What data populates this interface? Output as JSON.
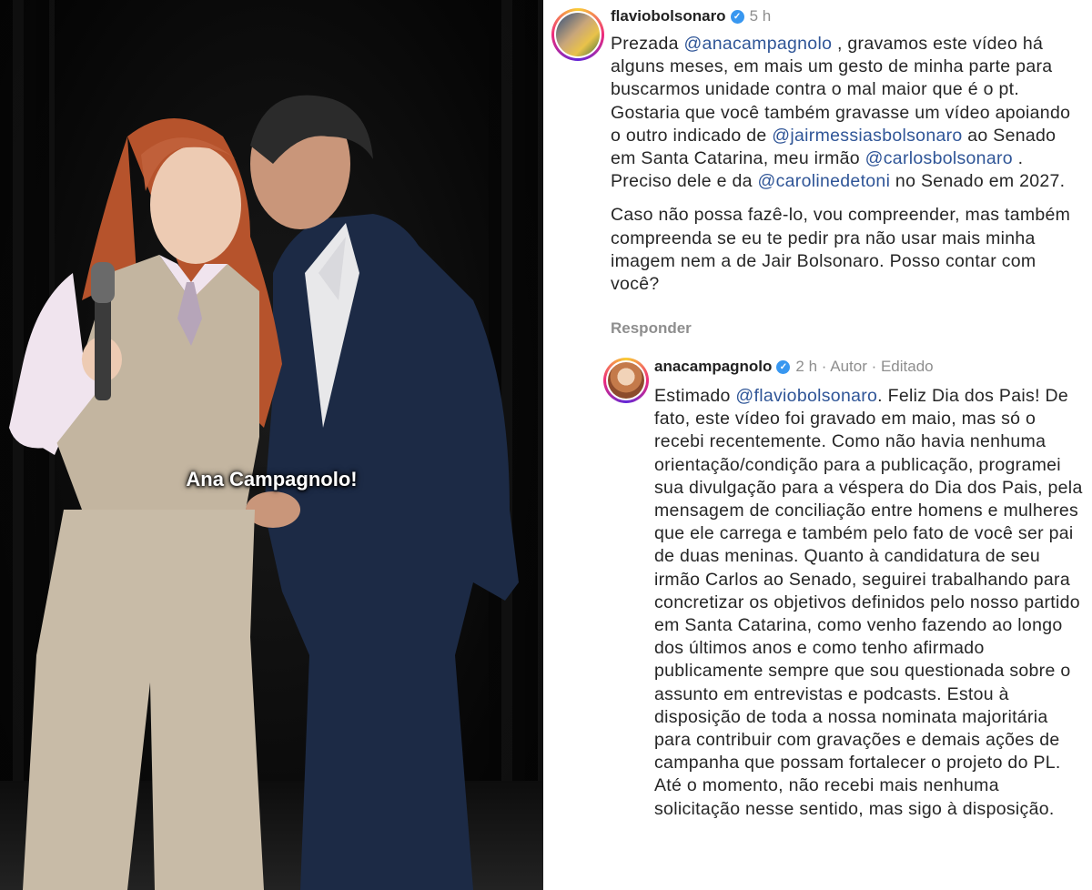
{
  "video": {
    "caption": "Ana Campagnolo!"
  },
  "comment1": {
    "username": "flaviobolsonaro",
    "time": "5 h",
    "segments": [
      {
        "t": "Prezada ",
        "m": false
      },
      {
        "t": "@anacampagnolo",
        "m": true
      },
      {
        "t": " , gravamos este vídeo há alguns meses, em mais um gesto de minha parte para buscarmos unidade contra o mal maior que é o pt. Gostaria que você também gravasse um vídeo apoiando o outro indicado de ",
        "m": false
      },
      {
        "t": "@jairmessiasbolsonaro",
        "m": true
      },
      {
        "t": " ao Senado em Santa Catarina, meu irmão ",
        "m": false
      },
      {
        "t": "@carlosbolsonaro",
        "m": true
      },
      {
        "t": " . Preciso dele e da ",
        "m": false
      },
      {
        "t": "@carolinedetoni",
        "m": true
      },
      {
        "t": " no Senado em 2027.",
        "m": false
      }
    ],
    "paragraph2": "Caso não possa fazê-lo, vou compreender, mas também compreenda se eu te pedir pra não usar mais minha imagem nem a de Jair Bolsonaro. Posso contar com você?",
    "reply_label": "Responder"
  },
  "comment2": {
    "username": "anacampagnolo",
    "meta": "2 h · Autor · Editado",
    "segments": [
      {
        "t": "Estimado ",
        "m": false
      },
      {
        "t": "@flaviobolsonaro",
        "m": true
      },
      {
        "t": ". Feliz Dia dos Pais! De fato, este vídeo foi gravado em maio, mas só o recebi recentemente. Como não havia nenhuma orientação/condição para a publicação, programei sua divulgação para a véspera do Dia dos Pais, pela mensagem de conciliação entre homens e mulheres que ele carrega e também pelo fato de você ser pai de duas meninas. Quanto à candidatura de seu irmão Carlos ao Senado, seguirei trabalhando para concretizar os objetivos definidos pelo nosso partido em Santa Catarina, como venho fazendo ao longo dos últimos anos e como tenho afirmado publicamente sempre que sou questionada sobre o assunto em entrevistas e podcasts. Estou à disposição de toda a nossa nominata majoritária para contribuir com gravações e demais ações de campanha que possam fortalecer o projeto do PL. Até o momento, não recebi mais nenhuma solicitação nesse sentido, mas sigo à disposição.",
        "m": false
      }
    ]
  },
  "colors": {
    "mention": "#2f5597",
    "verified": "#3897f0",
    "meta": "#8e8e8e"
  }
}
